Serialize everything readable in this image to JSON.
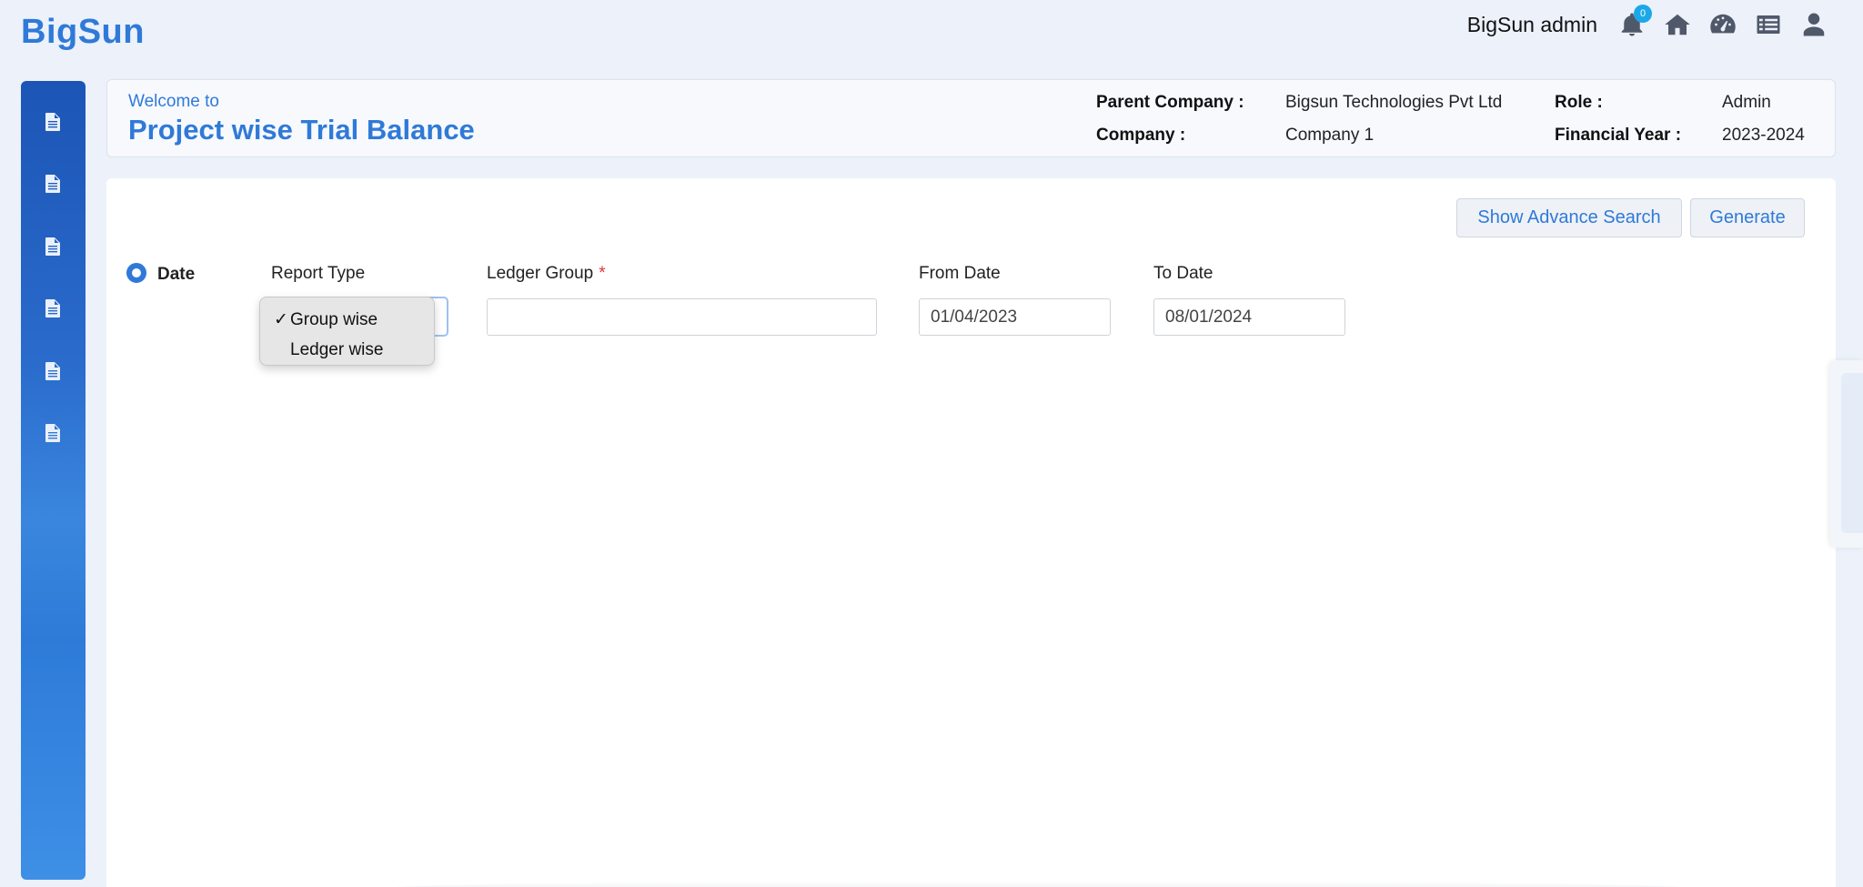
{
  "app": {
    "logo": "BigSun"
  },
  "topbar": {
    "user_name": "BigSun admin",
    "notification_count": "0",
    "icons": [
      "bell-icon",
      "home-icon",
      "dashboard-icon",
      "list-icon",
      "user-icon"
    ]
  },
  "sidebar": {
    "items": [
      "document-icon",
      "document-icon",
      "document-icon",
      "document-icon",
      "document-icon",
      "document-icon"
    ]
  },
  "header": {
    "welcome": "Welcome to",
    "title": "Project wise Trial Balance",
    "parent_company_label": "Parent Company :",
    "parent_company_value": "Bigsun Technologies Pvt Ltd",
    "role_label": "Role :",
    "role_value": "Admin",
    "company_label": "Company :",
    "company_value": "Company 1",
    "financial_year_label": "Financial Year :",
    "financial_year_value": "2023-2024"
  },
  "actions": {
    "advance_search_label": "Show Advance Search",
    "generate_label": "Generate"
  },
  "form": {
    "date_radio_label": "Date",
    "date_radio_selected": true,
    "report_type_label": "Report Type",
    "report_type_options": [
      "Group wise",
      "Ledger wise"
    ],
    "report_type_selected": "Group wise",
    "ledger_group_label": "Ledger Group",
    "ledger_group_required_mark": "*",
    "ledger_group_value": "",
    "from_date_label": "From Date",
    "from_date_value": "01/04/2023",
    "to_date_label": "To Date",
    "to_date_value": "08/01/2024"
  },
  "colors": {
    "accent": "#2f7ad8",
    "sidebar": "#2a6bcc",
    "badge": "#1ca8e8",
    "required": "#d9383a"
  }
}
